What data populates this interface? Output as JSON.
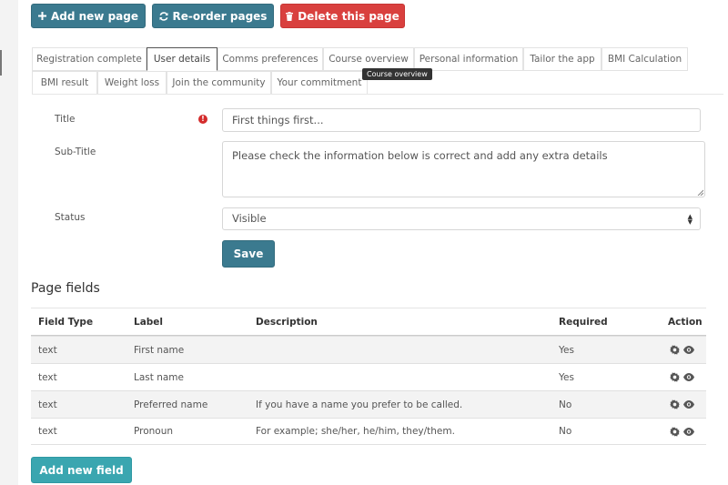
{
  "toolbar": {
    "add_page": "Add new page",
    "reorder": "Re-order pages",
    "delete": "Delete this page"
  },
  "tabs": [
    {
      "label": "Registration complete",
      "active": false
    },
    {
      "label": "User details",
      "active": true
    },
    {
      "label": "Comms preferences",
      "active": false
    },
    {
      "label": "Course overview",
      "active": false
    },
    {
      "label": "Personal information",
      "active": false
    },
    {
      "label": "Tailor the app",
      "active": false
    },
    {
      "label": "BMI Calculation",
      "active": false
    },
    {
      "label": "BMI result",
      "active": false
    },
    {
      "label": "Weight loss",
      "active": false
    },
    {
      "label": "Join the community",
      "active": false
    },
    {
      "label": "Your commitment",
      "active": false
    }
  ],
  "tooltip": "Course overview",
  "form": {
    "title_label": "Title",
    "title_value": "First things first...",
    "subtitle_label": "Sub-Title",
    "subtitle_value": "Please check the information below is correct and add any extra details",
    "status_label": "Status",
    "status_value": "Visible",
    "save_label": "Save"
  },
  "fields_section": {
    "title": "Page fields",
    "columns": [
      "Field Type",
      "Label",
      "Description",
      "Required",
      "Action"
    ],
    "rows": [
      {
        "type": "text",
        "label": "First name",
        "description": "",
        "required": "Yes"
      },
      {
        "type": "text",
        "label": "Last name",
        "description": "",
        "required": "Yes"
      },
      {
        "type": "text",
        "label": "Preferred name",
        "description": "If you have a name you prefer to be called.",
        "required": "No"
      },
      {
        "type": "text",
        "label": "Pronoun",
        "description": "For example; she/her, he/him, they/them.",
        "required": "No"
      }
    ],
    "add_field_label": "Add new field"
  },
  "colors": {
    "teal_button": "#3b7a8f",
    "danger_button": "#d9403e",
    "add_field_button": "#3aa6b0",
    "required_icon": "#d42c2c"
  },
  "icons": {
    "add": "plus-icon",
    "reorder": "refresh-icon",
    "delete": "trash-icon",
    "required": "exclamation-circle-icon",
    "settings": "gear-icon",
    "view": "eye-icon"
  }
}
